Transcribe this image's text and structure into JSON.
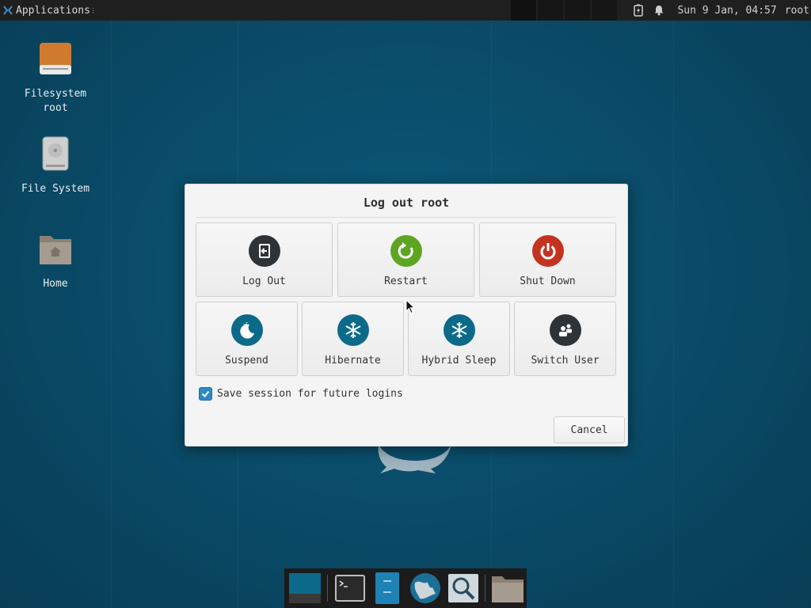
{
  "top_panel": {
    "applications_label": "Applications",
    "clock": "Sun  9 Jan, 04:57",
    "user": "root"
  },
  "desktop": {
    "icons": [
      {
        "label_line1": "Filesystem",
        "label_line2": "root"
      },
      {
        "label_line1": "File System",
        "label_line2": ""
      },
      {
        "label_line1": "Home",
        "label_line2": ""
      }
    ]
  },
  "dialog": {
    "title": "Log out root",
    "actions": [
      {
        "label": "Log Out",
        "icon": "logout-icon",
        "color": "#2d3336"
      },
      {
        "label": "Restart",
        "icon": "restart-icon",
        "color": "#5fa524"
      },
      {
        "label": "Shut Down",
        "icon": "power-icon",
        "color": "#c4331f"
      },
      {
        "label": "Suspend",
        "icon": "moon-sleep-icon",
        "color": "#0b6a8a"
      },
      {
        "label": "Hibernate",
        "icon": "snowflake-icon",
        "color": "#0b6a8a"
      },
      {
        "label": "Hybrid Sleep",
        "icon": "snowflake-icon",
        "color": "#0b6a8a"
      },
      {
        "label": "Switch User",
        "icon": "users-icon",
        "color": "#2d3336"
      }
    ],
    "save_session": {
      "label": "Save session for future logins",
      "checked": true
    },
    "cancel_label": "Cancel"
  },
  "dock": {
    "items": [
      "desktop-icon",
      "terminal-icon",
      "file-manager-icon",
      "web-browser-icon",
      "app-finder-icon",
      "folder-icon"
    ]
  }
}
